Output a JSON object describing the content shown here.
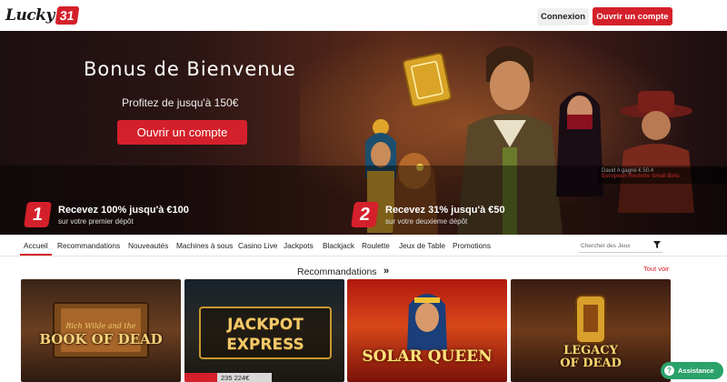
{
  "header": {
    "logo_text": "Lucky",
    "logo_number": "31",
    "login_label": "Connexion",
    "open_account_label": "Ouvrir un compte"
  },
  "hero": {
    "title": "Bonus de Bienvenue",
    "subtitle": "Profitez de jusqu'à 150€",
    "cta_label": "Ouvrir un compte",
    "win_notice": {
      "line": "David A gagné € 50.4",
      "game": "European Roulette Small Bets"
    }
  },
  "promos": [
    {
      "step": "1",
      "title": "Recevez 100% jusqu'à €100",
      "desc": "sur votre premier dépôt"
    },
    {
      "step": "2",
      "title": "Recevez 31% jusqu'à €50",
      "desc": "sur votre deuxieme dépôt"
    }
  ],
  "nav": {
    "items": [
      {
        "label": "Accueil",
        "active": true
      },
      {
        "label": "Recommandations"
      },
      {
        "label": "Nouveautés"
      },
      {
        "label": "Machines à sous"
      },
      {
        "label": "Casino Live"
      },
      {
        "label": "Jackpots"
      },
      {
        "label": "Blackjack"
      },
      {
        "label": "Roulette"
      },
      {
        "label": "Jeux de Table"
      },
      {
        "label": "Promotions"
      }
    ],
    "search_placeholder": "Chercher des Jeux",
    "filter_icon": "filter-icon"
  },
  "recommendations": {
    "title": "Recommandations",
    "arrows": "»",
    "see_all": "Tout voir",
    "games": [
      {
        "subtitle": "Rich Wilde and the",
        "name": "BOOK OF DEAD"
      },
      {
        "name_line1": "JACKPOT",
        "name_line2": "EXPRESS",
        "jackpot": "235 224€"
      },
      {
        "name": "SOLAR QUEEN"
      },
      {
        "name_line1": "LEGACY",
        "name_line2": "OF DEAD"
      }
    ]
  },
  "assistance": {
    "label": "Assistance"
  },
  "colors": {
    "brand_red": "#d4202a",
    "assist_green": "#2aa26a"
  }
}
